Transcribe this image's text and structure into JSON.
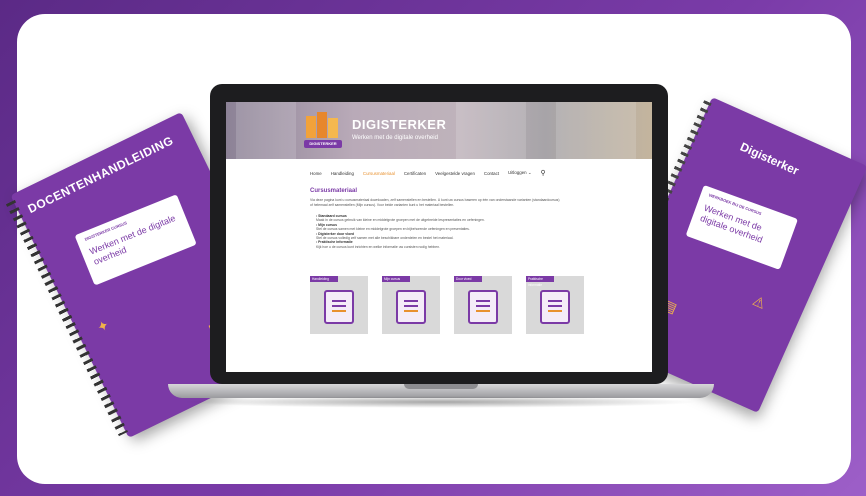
{
  "colors": {
    "brand_purple": "#7b3aa6",
    "accent_orange": "#e8912f",
    "frame_gradient_start": "#5b2a86",
    "frame_gradient_end": "#9d5fc8"
  },
  "booklet_left": {
    "title": "DOCENTENHANDLEIDING",
    "label_tag": "DIGISTERKER CURSUS",
    "label_text": "Werken met de digitale overheid"
  },
  "booklet_right": {
    "title": "Digisterker",
    "label_tag": "WERKBOEK BIJ DE CURSUS",
    "label_text": "Werken met de digitale overheid"
  },
  "website": {
    "logo_text": "DIGISTERKER",
    "brand": "DIGISTERKER",
    "tagline": "Werken met de digitale overheid",
    "nav": [
      {
        "label": "Home",
        "active": false
      },
      {
        "label": "Handleiding",
        "active": false
      },
      {
        "label": "Cursusmateriaal",
        "active": true
      },
      {
        "label": "Certificaten",
        "active": false
      },
      {
        "label": "Veelgestelde vragen",
        "active": false
      },
      {
        "label": "Contact",
        "active": false
      },
      {
        "label": "Uitloggen ⌄",
        "active": false
      }
    ],
    "search_icon": "search-icon",
    "page_title": "Cursusmateriaal",
    "intro": "Via deze pagina kunt u cursusmateriaal downloaden, zelf samenstellen en bestellen. U kunt uw cursus baseren op één van onderstaande varianten (standaardcursus) of helemaal zelf samenstellen (Mijn cursus). Voor beide varianten kunt u het materiaal bestellen.",
    "bullets": [
      {
        "head": "Standaard cursus",
        "text": "Maak in de cursus gebruik van kleine en middelgrote groepen met de uitgebreide lespresentaties en oefeningen."
      },
      {
        "head": "Mijn cursus",
        "text": "Stel de cursus samen met kleine en middelgrote groepen en bijbehorende oefeningen en presentaties."
      },
      {
        "head": "Digisterker door vloed",
        "text": "Stel de cursus volledig zelf samen met alle beschikbare onderdelen en bestel het materiaal."
      },
      {
        "head": "Praktische informatie",
        "text": "Kijk hoe u de cursus kunt inrichten en welke informatie uw cursisten nodig hebben."
      }
    ],
    "tiles": [
      {
        "label": "Handleiding"
      },
      {
        "label": "Mijn cursus"
      },
      {
        "label": "Door vloed"
      },
      {
        "label": "Praktische informatie"
      }
    ]
  }
}
